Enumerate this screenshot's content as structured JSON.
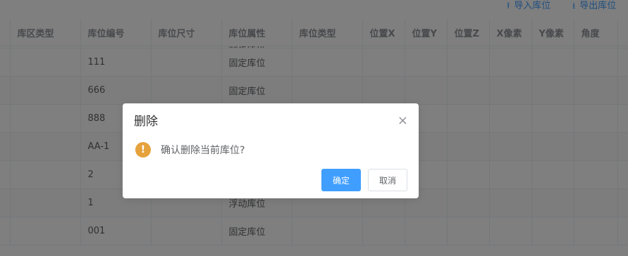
{
  "toolbar": {
    "import_label": "导入库位",
    "export_label": "导出库位"
  },
  "table": {
    "headers": [
      "",
      "库区类型",
      "库位编号",
      "库位尺寸",
      "库位属性",
      "库位类型",
      "位置X",
      "位置Y",
      "位置Z",
      "X像素",
      "Y像素",
      "角度",
      ""
    ],
    "partial_row_attr": "固定库位",
    "rows": [
      [
        "",
        "",
        "111",
        "",
        "固定库位",
        "",
        "",
        "",
        "",
        "",
        "",
        "",
        ""
      ],
      [
        "",
        "",
        "666",
        "",
        "固定库位",
        "",
        "",
        "",
        "",
        "",
        "",
        "",
        ""
      ],
      [
        "",
        "",
        "888",
        "",
        "",
        "",
        "",
        "",
        "",
        "",
        "",
        "",
        ""
      ],
      [
        "",
        "",
        "AA-1",
        "",
        "",
        "",
        "",
        "",
        "",
        "",
        "",
        "",
        ""
      ],
      [
        "",
        "",
        "2",
        "",
        "",
        "",
        "",
        "",
        "",
        "",
        "",
        "",
        ""
      ],
      [
        "",
        "",
        "1",
        "",
        "浮动库位",
        "",
        "",
        "",
        "",
        "",
        "",
        "",
        ""
      ],
      [
        "",
        "",
        "001",
        "",
        "固定库位",
        "",
        "",
        "",
        "",
        "",
        "",
        "",
        ""
      ]
    ]
  },
  "dialog": {
    "title": "删除",
    "message": "确认删除当前库位?",
    "confirm_label": "确定",
    "cancel_label": "取消",
    "warning_glyph": "!",
    "close_glyph": "×"
  },
  "colors": {
    "primary": "#409eff",
    "warning": "#e6a23c"
  }
}
